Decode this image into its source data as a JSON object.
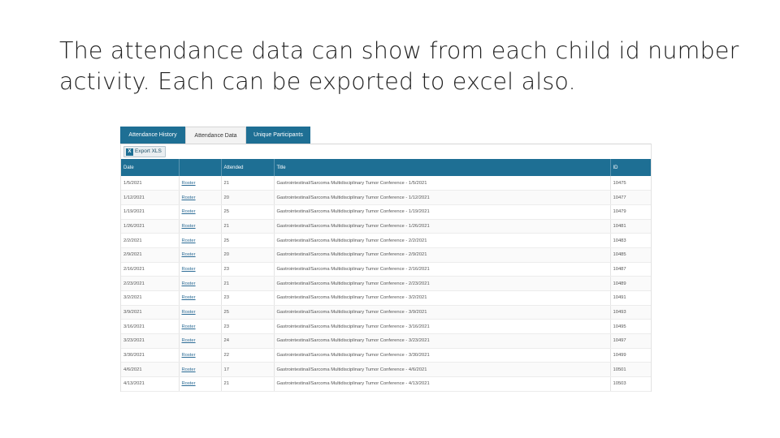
{
  "slide": {
    "title": "The attendance data can show from each child id number activity. Each can be exported to excel also."
  },
  "tabs": [
    {
      "label": "Attendance History",
      "active": false
    },
    {
      "label": "Attendance Data",
      "active": true
    },
    {
      "label": "Unique Participants",
      "active": false
    }
  ],
  "toolbar": {
    "export_icon": "excel-icon",
    "export_label": "Export XLS"
  },
  "table": {
    "columns": [
      "Date",
      "",
      "Attended",
      "Title",
      "ID"
    ],
    "rows": [
      {
        "date": "1/5/2021",
        "link": "Roster",
        "attended": "21",
        "title": "Gastrointestinal/Sarcoma Multidisciplinary Tumor Conference - 1/5/2021",
        "id": "10475"
      },
      {
        "date": "1/12/2021",
        "link": "Roster",
        "attended": "20",
        "title": "Gastrointestinal/Sarcoma Multidisciplinary Tumor Conference - 1/12/2021",
        "id": "10477"
      },
      {
        "date": "1/19/2021",
        "link": "Roster",
        "attended": "25",
        "title": "Gastrointestinal/Sarcoma Multidisciplinary Tumor Conference - 1/19/2021",
        "id": "10479"
      },
      {
        "date": "1/26/2021",
        "link": "Roster",
        "attended": "21",
        "title": "Gastrointestinal/Sarcoma Multidisciplinary Tumor Conference - 1/26/2021",
        "id": "10481"
      },
      {
        "date": "2/2/2021",
        "link": "Roster",
        "attended": "25",
        "title": "Gastrointestinal/Sarcoma Multidisciplinary Tumor Conference - 2/2/2021",
        "id": "10483"
      },
      {
        "date": "2/9/2021",
        "link": "Roster",
        "attended": "20",
        "title": "Gastrointestinal/Sarcoma Multidisciplinary Tumor Conference - 2/9/2021",
        "id": "10485"
      },
      {
        "date": "2/16/2021",
        "link": "Roster",
        "attended": "23",
        "title": "Gastrointestinal/Sarcoma Multidisciplinary Tumor Conference - 2/16/2021",
        "id": "10487"
      },
      {
        "date": "2/23/2021",
        "link": "Roster",
        "attended": "21",
        "title": "Gastrointestinal/Sarcoma Multidisciplinary Tumor Conference - 2/23/2021",
        "id": "10489"
      },
      {
        "date": "3/2/2021",
        "link": "Roster",
        "attended": "23",
        "title": "Gastrointestinal/Sarcoma Multidisciplinary Tumor Conference - 3/2/2021",
        "id": "10491"
      },
      {
        "date": "3/9/2021",
        "link": "Roster",
        "attended": "25",
        "title": "Gastrointestinal/Sarcoma Multidisciplinary Tumor Conference - 3/9/2021",
        "id": "10493"
      },
      {
        "date": "3/16/2021",
        "link": "Roster",
        "attended": "23",
        "title": "Gastrointestinal/Sarcoma Multidisciplinary Tumor Conference - 3/16/2021",
        "id": "10495"
      },
      {
        "date": "3/23/2021",
        "link": "Roster",
        "attended": "24",
        "title": "Gastrointestinal/Sarcoma Multidisciplinary Tumor Conference - 3/23/2021",
        "id": "10497"
      },
      {
        "date": "3/30/2021",
        "link": "Roster",
        "attended": "22",
        "title": "Gastrointestinal/Sarcoma Multidisciplinary Tumor Conference - 3/30/2021",
        "id": "10499"
      },
      {
        "date": "4/6/2021",
        "link": "Roster",
        "attended": "17",
        "title": "Gastrointestinal/Sarcoma Multidisciplinary Tumor Conference - 4/6/2021",
        "id": "10501"
      },
      {
        "date": "4/13/2021",
        "link": "Roster",
        "attended": "21",
        "title": "Gastrointestinal/Sarcoma Multidisciplinary Tumor Conference - 4/13/2021",
        "id": "10503"
      }
    ]
  }
}
